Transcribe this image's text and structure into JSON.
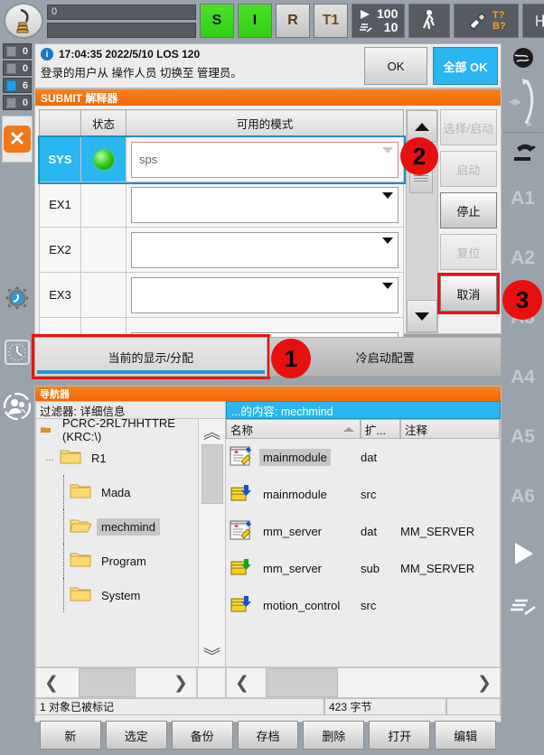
{
  "statusbar": {
    "message_fields": [
      "0",
      ""
    ],
    "drives": {
      "s_label": "S",
      "i_label": "I"
    },
    "mode_r": "R",
    "mode_t1": "T1",
    "override_program": "100",
    "override_jog": "10",
    "tool_label": "T?",
    "base_label": "B?",
    "increment": "∞"
  },
  "counters": [
    {
      "name": "error-counter",
      "value": "0"
    },
    {
      "name": "warning-counter",
      "value": "0"
    },
    {
      "name": "info-counter",
      "value": "6"
    },
    {
      "name": "wait-counter",
      "value": "0"
    }
  ],
  "message": {
    "icon": "info-icon",
    "timestamp": "17:04:35 2022/5/10 LOS 120",
    "text": "登录的用户从 操作人员 切换至 管理员。",
    "ok_label": "OK",
    "ok_all_label": "全部 OK"
  },
  "submit": {
    "title": "SUBMIT 解释器",
    "columns": [
      "",
      "状态",
      "可用的模式"
    ],
    "rows": [
      {
        "id": "SYS",
        "status": "running",
        "mode": "sps",
        "selected": true
      },
      {
        "id": "EX1",
        "status": "",
        "mode": "",
        "selected": false
      },
      {
        "id": "EX2",
        "status": "",
        "mode": "",
        "selected": false
      },
      {
        "id": "EX3",
        "status": "",
        "mode": "",
        "selected": false
      },
      {
        "id": "",
        "status": "",
        "mode": "",
        "selected": false
      }
    ],
    "commands": [
      {
        "label": "选择/启动",
        "enabled": false,
        "highlight": false
      },
      {
        "label": "启动",
        "enabled": false,
        "highlight": false
      },
      {
        "label": "停止",
        "enabled": true,
        "highlight": false
      },
      {
        "label": "复位",
        "enabled": false,
        "highlight": false
      },
      {
        "label": "取消",
        "enabled": true,
        "highlight": true
      }
    ]
  },
  "allocation": {
    "current_label": "当前的显示/分配",
    "coldstart_label": "冷启动配置"
  },
  "navigator": {
    "title": "导航器",
    "filter_label": "过滤器: 详细信息",
    "content_label": "...的内容: mechmind",
    "tree": {
      "root": "PCRC-2RL7HHTTRE (KRC:\\)",
      "items": [
        {
          "label": "R1",
          "depth": 0,
          "selected": false
        },
        {
          "label": "Mada",
          "depth": 1,
          "selected": false
        },
        {
          "label": "mechmind",
          "depth": 1,
          "selected": true
        },
        {
          "label": "Program",
          "depth": 1,
          "selected": false
        },
        {
          "label": "System",
          "depth": 1,
          "selected": false
        }
      ]
    },
    "list": {
      "headers": {
        "name": "名称",
        "ext": "扩...",
        "comment": "注释"
      },
      "files": [
        {
          "name": "mainmodule",
          "ext": "dat",
          "comment": "",
          "icon": "dat-module-icon",
          "selected": true
        },
        {
          "name": "mainmodule",
          "ext": "src",
          "comment": "",
          "icon": "src-module-icon",
          "selected": false
        },
        {
          "name": "mm_server",
          "ext": "dat",
          "comment": "MM_SERVER",
          "icon": "dat-module-icon",
          "selected": false
        },
        {
          "name": "mm_server",
          "ext": "sub",
          "comment": "MM_SERVER",
          "icon": "sub-module-icon",
          "selected": false
        },
        {
          "name": "motion_control",
          "ext": "src",
          "comment": "",
          "icon": "src-module-icon",
          "selected": false
        }
      ]
    },
    "status": {
      "marked": "1 对象已被标记",
      "size": "423 字节",
      "extra": ""
    },
    "buttons": [
      "新",
      "选定",
      "备份",
      "存档",
      "删除",
      "打开",
      "编辑"
    ]
  },
  "right_toolbar": {
    "axes": [
      "A1",
      "A2",
      "A3",
      "A4",
      "A5",
      "A6"
    ]
  },
  "badges": [
    {
      "number": "1",
      "target": "current-display-allocation-button"
    },
    {
      "number": "2",
      "target": "submit-table-scrollbar"
    },
    {
      "number": "3",
      "target": "cancel-button"
    }
  ],
  "colors": {
    "accent_orange": "#ef6a05",
    "accent_blue": "#29b6f2",
    "badge_red": "#e80f0f",
    "drives_green": "#2fcf12"
  }
}
